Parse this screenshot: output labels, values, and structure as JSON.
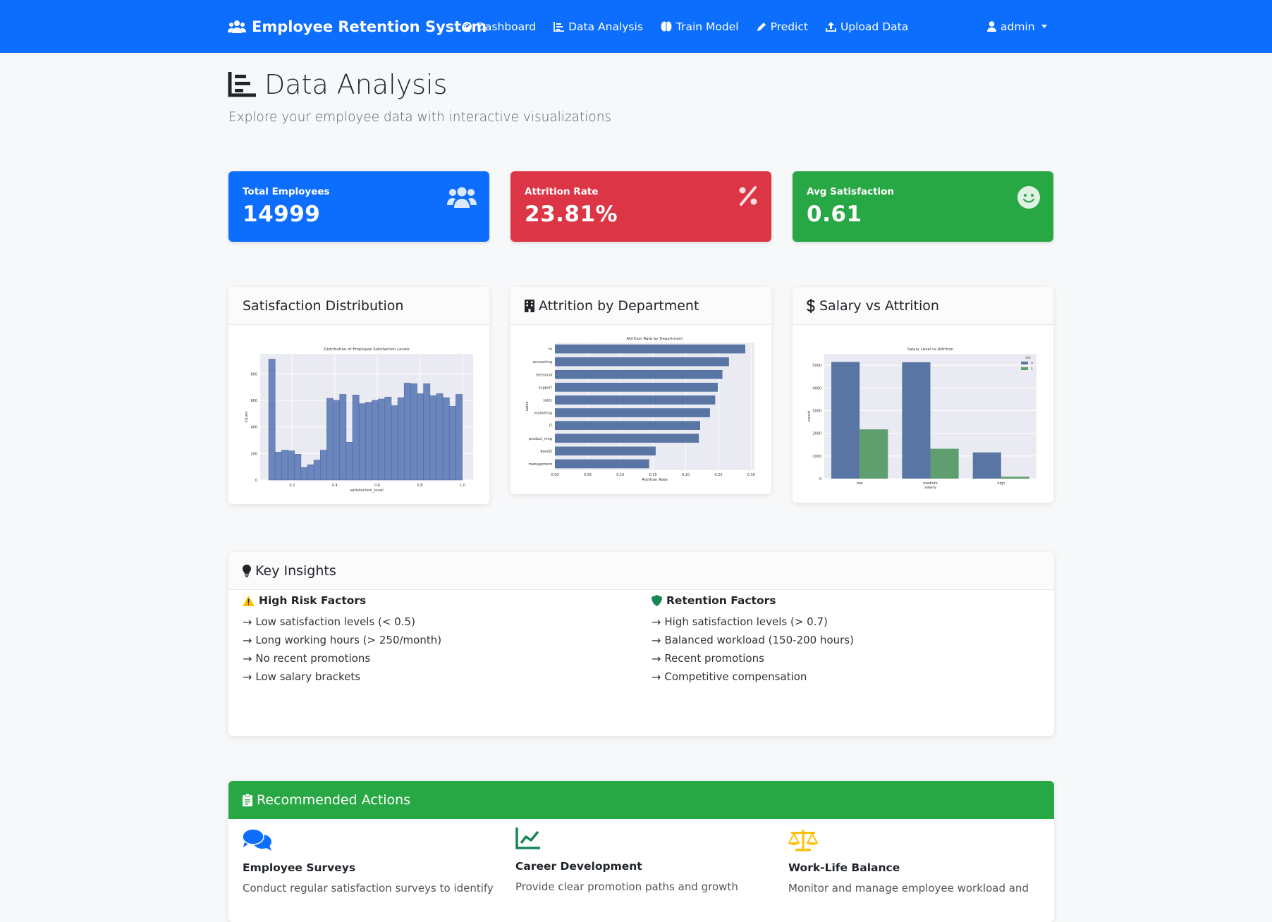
{
  "nav": {
    "brand": "Employee Retention System",
    "items": [
      {
        "label": "Dashboard",
        "icon": "tachometer-icon"
      },
      {
        "label": "Data Analysis",
        "icon": "chart-icon"
      },
      {
        "label": "Train Model",
        "icon": "brain-icon"
      },
      {
        "label": "Predict",
        "icon": "pencil-icon"
      },
      {
        "label": "Upload Data",
        "icon": "upload-icon"
      }
    ],
    "user": "admin"
  },
  "page": {
    "title": "Data Analysis",
    "subtitle": "Explore your employee data with interactive visualizations"
  },
  "stats": [
    {
      "label": "Total Employees",
      "value": "14999",
      "color": "#0d6efd",
      "icon": "users-icon"
    },
    {
      "label": "Attrition Rate",
      "value": "23.81%",
      "color": "#dc3545",
      "icon": "percent-icon"
    },
    {
      "label": "Avg Satisfaction",
      "value": "0.61",
      "color": "#28a745",
      "icon": "smile-icon"
    }
  ],
  "cards": {
    "satisfaction": "Satisfaction Distribution",
    "department": "Attrition by Department",
    "salary": "Salary vs Attrition"
  },
  "chart_data": [
    {
      "type": "bar",
      "title": "Distribution of Employee Satisfaction Levels",
      "xlabel": "satisfaction_level",
      "ylabel": "Count",
      "xlim": [
        0.05,
        1.05
      ],
      "ylim": [
        0,
        950
      ],
      "x_ticks": [
        "0.2",
        "0.4",
        "0.6",
        "0.8",
        "1.0"
      ],
      "y_ticks": [
        "0",
        "200",
        "400",
        "600",
        "800"
      ],
      "bin_start": 0.09,
      "bin_width": 0.0303,
      "values": [
        910,
        210,
        225,
        220,
        195,
        95,
        115,
        150,
        225,
        615,
        600,
        645,
        285,
        640,
        575,
        585,
        600,
        610,
        625,
        560,
        620,
        730,
        725,
        650,
        725,
        635,
        650,
        620,
        555,
        645
      ]
    },
    {
      "type": "bar",
      "orientation": "horizontal",
      "title": "Attrition Rate by Department",
      "xlabel": "Attrition Rate",
      "ylabel": "sales",
      "xlim": [
        0,
        0.305
      ],
      "x_ticks": [
        "0.00",
        "0.05",
        "0.10",
        "0.15",
        "0.20",
        "0.25",
        "0.30"
      ],
      "categories": [
        "hr",
        "accounting",
        "technical",
        "support",
        "sales",
        "marketing",
        "IT",
        "product_mng",
        "RandD",
        "management"
      ],
      "values": [
        0.291,
        0.266,
        0.256,
        0.249,
        0.245,
        0.237,
        0.222,
        0.22,
        0.154,
        0.144
      ]
    },
    {
      "type": "bar",
      "title": "Salary Level vs Attrition",
      "xlabel": "salary",
      "ylabel": "count",
      "ylim": [
        0,
        5500
      ],
      "y_ticks": [
        "0",
        "1000",
        "2000",
        "3000",
        "4000",
        "5000"
      ],
      "categories": [
        "low",
        "medium",
        "high"
      ],
      "legend_title": "left",
      "legend_position": "top-right",
      "series": [
        {
          "name": "0",
          "values": [
            5144,
            5129,
            1155
          ],
          "color": "#5875a4"
        },
        {
          "name": "1",
          "values": [
            2172,
            1317,
            82
          ],
          "color": "#5f9e6e"
        }
      ]
    }
  ],
  "insights": {
    "title": "Key Insights",
    "risk": {
      "title": "High Risk Factors",
      "items": [
        "Low satisfaction levels (< 0.5)",
        "Long working hours (> 250/month)",
        "No recent promotions",
        "Low salary brackets"
      ]
    },
    "retention": {
      "title": "Retention Factors",
      "items": [
        "High satisfaction levels (> 0.7)",
        "Balanced workload (150-200 hours)",
        "Recent promotions",
        "Competitive compensation"
      ]
    },
    "arrow": "→"
  },
  "recommended": {
    "title": "Recommended Actions",
    "items": [
      {
        "title": "Employee Surveys",
        "desc": "Conduct regular satisfaction surveys to identify",
        "icon": "comments-icon",
        "color": "#0d6efd"
      },
      {
        "title": "Career Development",
        "desc": "Provide clear promotion paths and growth",
        "icon": "chart-line-icon",
        "color": "#198754"
      },
      {
        "title": "Work-Life Balance",
        "desc": "Monitor and manage employee workload and",
        "icon": "balance-scale-icon",
        "color": "#ffc107"
      }
    ]
  }
}
